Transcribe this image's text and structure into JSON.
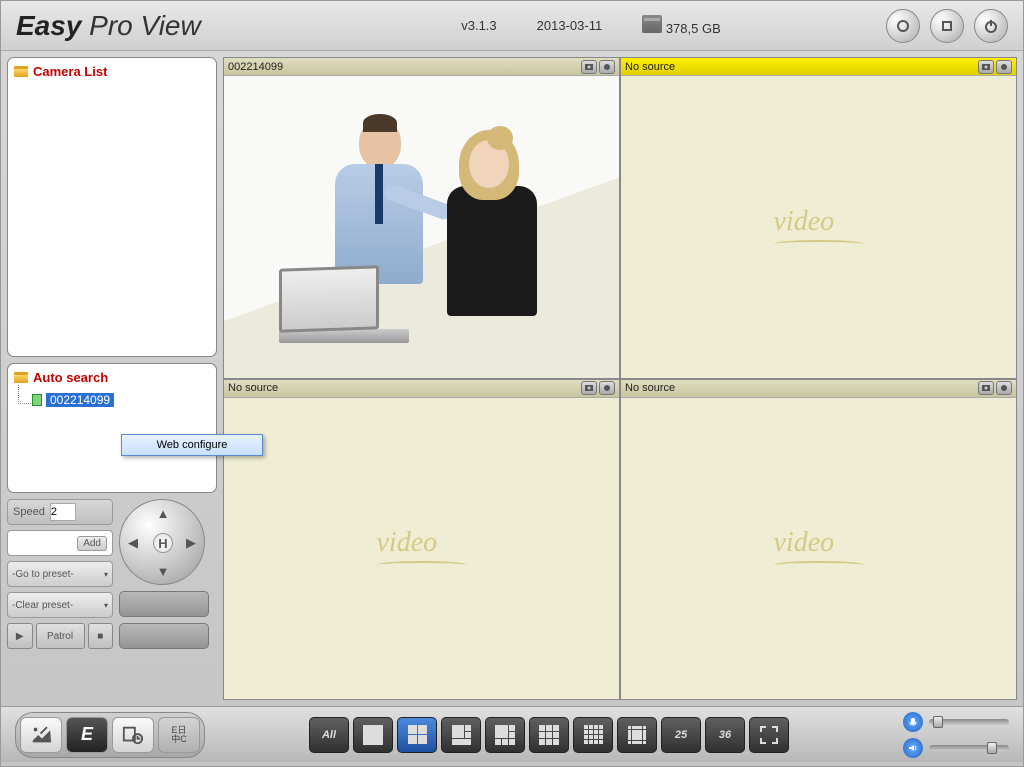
{
  "app": {
    "name_bold": "Easy",
    "name_light": " Pro View",
    "version": "v3.1.3",
    "date": "2013-03-11",
    "storage": "378,5 GB"
  },
  "sidebar": {
    "camera_list_title": "Camera List",
    "auto_search_title": "Auto search",
    "found_device": "002214099"
  },
  "context_menu": {
    "item1": "Web configure"
  },
  "ptz": {
    "speed_label": "Speed",
    "speed_value": "2",
    "add_label": "Add",
    "goto_preset": "-Go to preset-",
    "clear_preset": "-Clear preset-",
    "patrol_label": "Patrol",
    "home_label": "H"
  },
  "cells": [
    {
      "title": "002214099",
      "has_feed": true,
      "active": false
    },
    {
      "title": "No source",
      "has_feed": false,
      "active": true
    },
    {
      "title": "No source",
      "has_feed": false,
      "active": false
    },
    {
      "title": "No source",
      "has_feed": false,
      "active": false
    }
  ],
  "video_placeholder": "video",
  "footer": {
    "all_label": "All",
    "lang_btn": "E日\n中C",
    "n25": "25",
    "n36": "36"
  }
}
